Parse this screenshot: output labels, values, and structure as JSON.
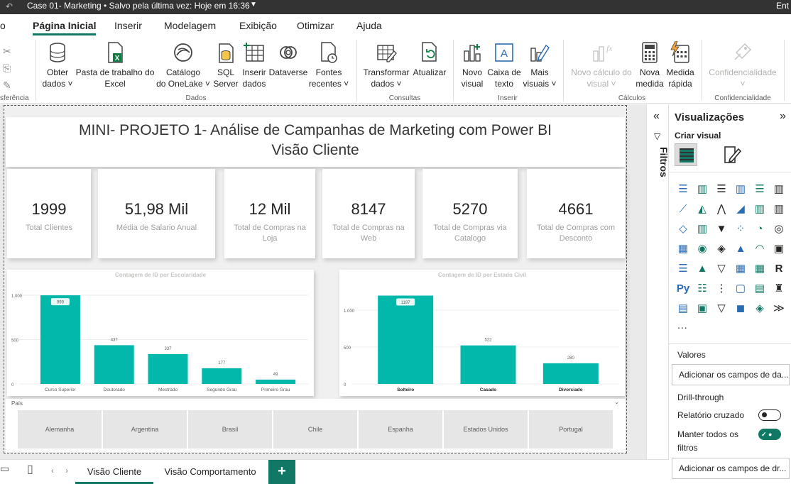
{
  "titlebar": {
    "title": "Case 01- Marketing • Salvo pela última vez: Hoje em 16:36",
    "right_text": "Ent"
  },
  "ribbon_tabs": [
    "o",
    "Página Inicial",
    "Inserir",
    "Modelagem",
    "Exibição",
    "Otimizar",
    "Ajuda"
  ],
  "ribbon": {
    "clipboard_group": "sferência",
    "dados_group": "Dados",
    "consultas_group": "Consultas",
    "inserir_group": "Inserir",
    "calculos_group": "Cálculos",
    "confidencialidade_group": "Confidencialidade",
    "buttons": {
      "obter_dados": [
        "Obter",
        "dados ˅"
      ],
      "pasta_trabalho": [
        "Pasta de trabalho do",
        "Excel"
      ],
      "catalogo": [
        "Catálogo",
        "do OneLake ˅"
      ],
      "sql": [
        "SQL",
        "Server"
      ],
      "inserir_dados": [
        "Inserir",
        "dados"
      ],
      "dataverse": [
        "Dataverse",
        ""
      ],
      "fontes": [
        "Fontes",
        "recentes ˅"
      ],
      "transformar": [
        "Transformar",
        "dados ˅"
      ],
      "atualizar": [
        "Atualizar",
        ""
      ],
      "novo_visual": [
        "Novo",
        "visual"
      ],
      "caixa_texto": [
        "Caixa de",
        "texto"
      ],
      "mais_visuais": [
        "Mais",
        "visuais ˅"
      ],
      "novo_calculo": [
        "Novo cálculo do",
        "visual ˅"
      ],
      "nova_medida": [
        "Nova",
        "medida"
      ],
      "medida_rapida": [
        "Medida",
        "rápida"
      ],
      "confidencialidade": [
        "Confidencialidade",
        "˅"
      ]
    }
  },
  "report": {
    "title_line1": "MINI- PROJETO 1- Análise de Campanhas de Marketing  com Power BI",
    "title_line2": "Visão Cliente",
    "kpis": [
      {
        "value": "1999",
        "label": "Total Clientes"
      },
      {
        "value": "51,98 Mil",
        "label": "Média de Salario Anual"
      },
      {
        "value": "12 Mil",
        "label": "Total de Compras na Loja"
      },
      {
        "value": "8147",
        "label": "Total de Compras na Web"
      },
      {
        "value": "5270",
        "label": "Total de Compras via Catalogo"
      },
      {
        "value": "4661",
        "label": "Total  de Compras com Desconto"
      }
    ],
    "slicer": {
      "label": "País",
      "items": [
        "Alemanha",
        "Argentina",
        "Brasil",
        "Chile",
        "Espanha",
        "Estados Unidos",
        "Portugal"
      ]
    }
  },
  "chart_data": [
    {
      "type": "bar",
      "title": "Contagem de ID por Escolaridade",
      "categories": [
        "Curso Superior",
        "Doutorado",
        "Mestrado",
        "Segundo Grau",
        "Primeiro Grau"
      ],
      "values": [
        999,
        437,
        337,
        177,
        49
      ],
      "ylim": [
        0,
        1000
      ],
      "yticks": [
        "0",
        "500",
        "1.000"
      ],
      "grid": true,
      "bar_color": "#01B8AA"
    },
    {
      "type": "bar",
      "title": "Contagem de ID por Estado Civil",
      "categories": [
        "Solteiro",
        "Casado",
        "Divorciado"
      ],
      "values": [
        1197,
        522,
        280
      ],
      "ylim": [
        0,
        1000
      ],
      "yticks": [
        "0",
        "500",
        "1.000"
      ],
      "grid": true,
      "bar_color": "#01B8AA"
    }
  ],
  "filters_pane": {
    "label": "Filtros"
  },
  "viz_pane": {
    "title": "Visualizações",
    "criar_visual": "Criar visual",
    "more": "...",
    "valores_label": "Valores",
    "valores_placeholder": "Adicionar os campos de da...",
    "drillthrough_label": "Drill-through",
    "relatorio_cruzado_label": "Relatório cruzado",
    "manter_filtros_label_1": "Manter todos os",
    "manter_filtros_label_2": "filtros",
    "drill_placeholder": "Adicionar os campos de dr..."
  },
  "page_tabs": {
    "tabs": [
      "Visão Cliente",
      "Visão Comportamento"
    ],
    "add_label": "+"
  },
  "colors": {
    "accent": "#117865",
    "bar": "#01B8AA"
  }
}
